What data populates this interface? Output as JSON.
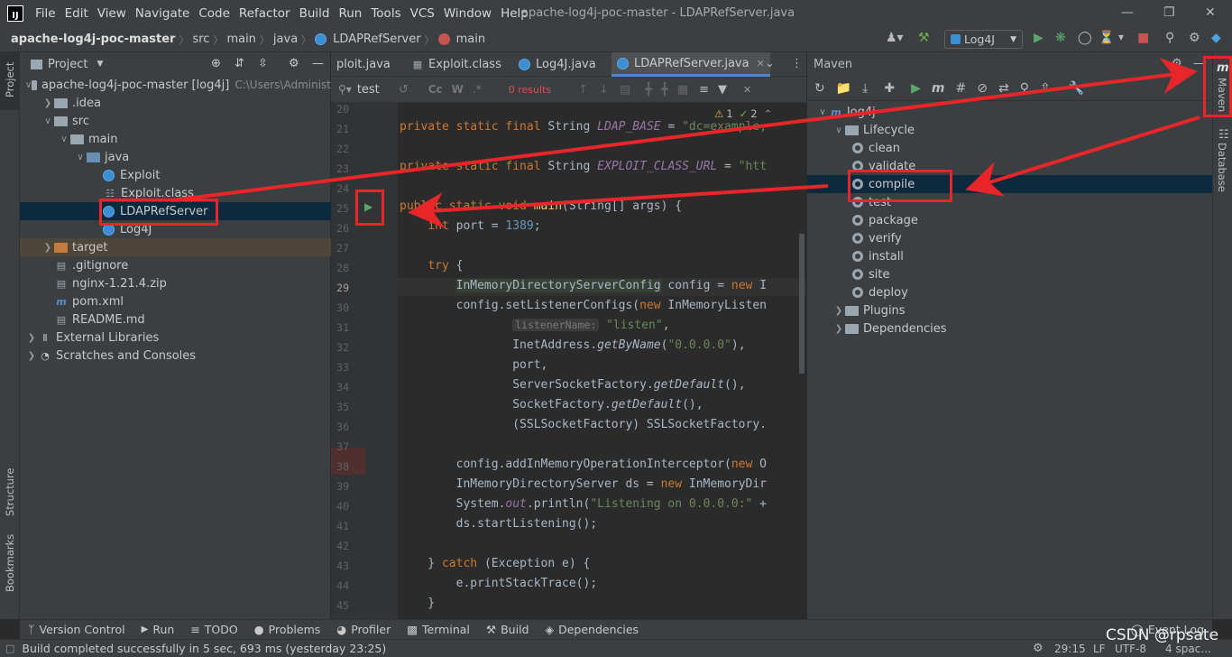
{
  "menu": [
    "File",
    "Edit",
    "View",
    "Navigate",
    "Code",
    "Refactor",
    "Build",
    "Run",
    "Tools",
    "VCS",
    "Window",
    "Help"
  ],
  "window_title": "apache-log4j-poc-master - LDAPRefServer.java",
  "breadcrumb": [
    "apache-log4j-poc-master",
    "src",
    "main",
    "java",
    "LDAPRefServer",
    "main"
  ],
  "run_config": "Log4J",
  "left_strip": {
    "project": "Project",
    "structure": "Structure",
    "bookmarks": "Bookmarks"
  },
  "right_strip": {
    "maven": "Maven",
    "database": "Database"
  },
  "project_panel": {
    "title": "Project",
    "tree": [
      {
        "label": "apache-log4j-poc-master",
        "extra": "[log4j]",
        "path": "C:\\Users\\Administ",
        "level": 0,
        "arrow": "v",
        "kind": "module"
      },
      {
        "label": ".idea",
        "level": 1,
        "arrow": ">",
        "kind": "folder"
      },
      {
        "label": "src",
        "level": 1,
        "arrow": "v",
        "kind": "folder"
      },
      {
        "label": "main",
        "level": 2,
        "arrow": "v",
        "kind": "folder"
      },
      {
        "label": "java",
        "level": 3,
        "arrow": "v",
        "kind": "folder-blue"
      },
      {
        "label": "Exploit",
        "level": 4,
        "arrow": "",
        "kind": "class"
      },
      {
        "label": "Exploit.class",
        "level": 4,
        "arrow": "",
        "kind": "classfile"
      },
      {
        "label": "LDAPRefServer",
        "level": 4,
        "arrow": "",
        "kind": "class",
        "selected": true
      },
      {
        "label": "Log4J",
        "level": 4,
        "arrow": "",
        "kind": "class"
      },
      {
        "label": "target",
        "level": 1,
        "arrow": ">",
        "kind": "folder-orange",
        "excluded": true
      },
      {
        "label": ".gitignore",
        "level": 1,
        "arrow": "",
        "kind": "file"
      },
      {
        "label": "nginx-1.21.4.zip",
        "level": 1,
        "arrow": "",
        "kind": "file"
      },
      {
        "label": "pom.xml",
        "level": 1,
        "arrow": "",
        "kind": "maven"
      },
      {
        "label": "README.md",
        "level": 1,
        "arrow": "",
        "kind": "file"
      },
      {
        "label": "External Libraries",
        "level": 0,
        "arrow": ">",
        "kind": "lib"
      },
      {
        "label": "Scratches and Consoles",
        "level": 0,
        "arrow": ">",
        "kind": "scratch"
      }
    ]
  },
  "editor_tabs": [
    {
      "label": "ploit.java",
      "active": false
    },
    {
      "label": "Exploit.class",
      "active": false
    },
    {
      "label": "Log4J.java",
      "active": false
    },
    {
      "label": "LDAPRefServer.java",
      "active": true
    }
  ],
  "find": {
    "query": "test",
    "results": "0 results",
    "cc": "Cc",
    "w": "W",
    "regex": ".*"
  },
  "inspections": {
    "warnings": "1",
    "weak": "2"
  },
  "code": {
    "l20": "20",
    "l21": "21",
    "l22": "22",
    "l23": "23",
    "l24": "24",
    "l25": "25",
    "l26": "26",
    "l27": "27",
    "l28": "28",
    "l29": "29",
    "l30": "30",
    "l31": "31",
    "l32": "32",
    "l33": "33",
    "l34": "34",
    "l35": "35",
    "l36": "36",
    "l37": "37",
    "l38": "38",
    "l39": "39",
    "l40": "40",
    "l41": "41",
    "l42": "42",
    "l43": "43",
    "l44": "44",
    "l45": "45",
    "ldap_base_value": "\"dc=example,",
    "exploit_url_value": "\"htt",
    "port_value": "1389",
    "listener_hint": "listenerName:",
    "listen_str": "\"listen\"",
    "ip_str": "\"0.0.0.0\"",
    "listening_str": "\"Listening on 0.0.0.0:\""
  },
  "maven_panel": {
    "title": "Maven",
    "tree": [
      {
        "label": "log4j",
        "level": 0,
        "arrow": "v"
      },
      {
        "label": "Lifecycle",
        "level": 1,
        "arrow": "v"
      },
      {
        "label": "clean",
        "level": 2
      },
      {
        "label": "validate",
        "level": 2
      },
      {
        "label": "compile",
        "level": 2,
        "selected": true
      },
      {
        "label": "test",
        "level": 2
      },
      {
        "label": "package",
        "level": 2
      },
      {
        "label": "verify",
        "level": 2
      },
      {
        "label": "install",
        "level": 2
      },
      {
        "label": "site",
        "level": 2
      },
      {
        "label": "deploy",
        "level": 2
      },
      {
        "label": "Plugins",
        "level": 1,
        "arrow": ">"
      },
      {
        "label": "Dependencies",
        "level": 1,
        "arrow": ">"
      }
    ]
  },
  "bottom_tools": [
    "Version Control",
    "Run",
    "TODO",
    "Problems",
    "Profiler",
    "Terminal",
    "Build",
    "Dependencies"
  ],
  "event_log": "Event Log",
  "status": {
    "message": "Build completed successfully in 5 sec, 693 ms (yesterday 23:25)",
    "position": "29:15",
    "line_sep": "LF",
    "encoding": "UTF-8",
    "indent": "4 spac..."
  },
  "watermark": "CSDN @rpsate",
  "annotation_color": "#e8262a"
}
